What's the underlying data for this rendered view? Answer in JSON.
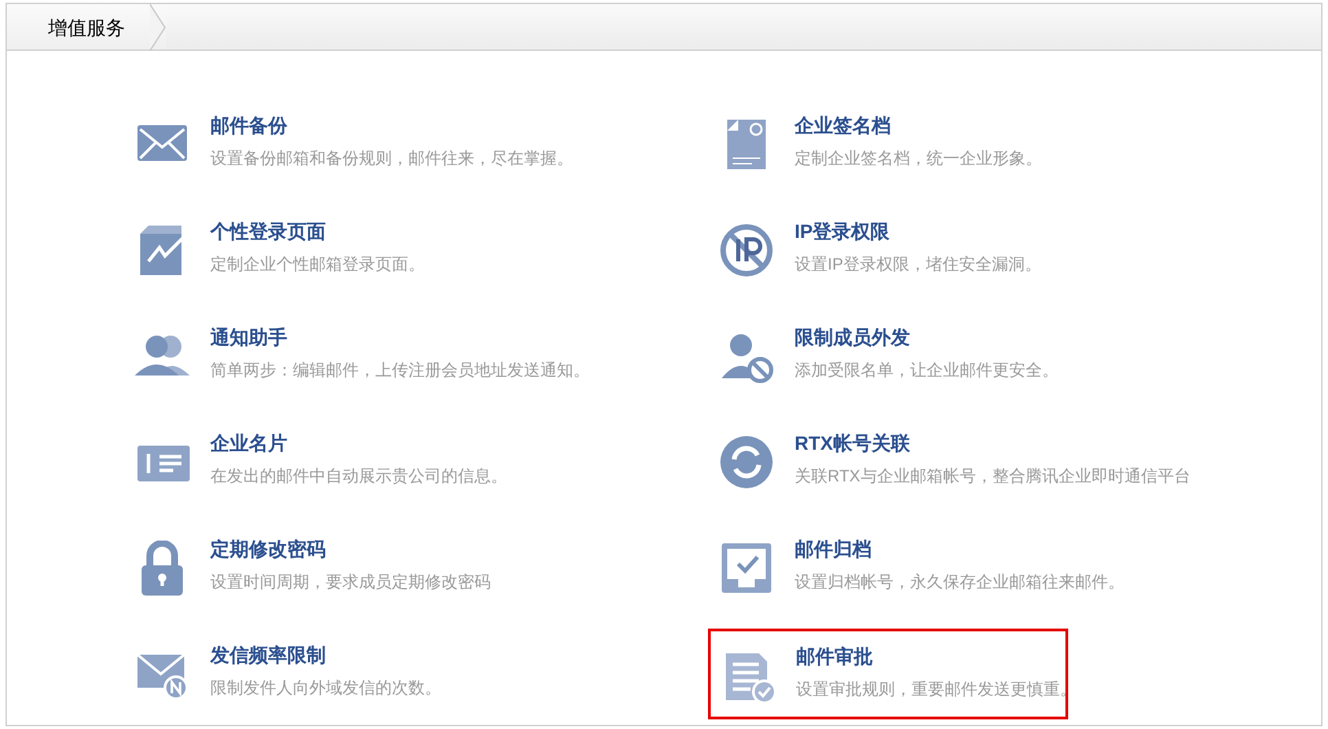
{
  "tab": {
    "label": "增值服务",
    "selected": true
  },
  "services": [
    {
      "title": "邮件备份",
      "description": "设置备份邮箱和备份规则，邮件往来，尽在掌握。",
      "highlighted": false
    },
    {
      "title": "企业签名档",
      "description": "定制企业签名档，统一企业形象。",
      "highlighted": false
    },
    {
      "title": "个性登录页面",
      "description": "定制企业个性邮箱登录页面。",
      "highlighted": false
    },
    {
      "title": "IP登录权限",
      "description": "设置IP登录权限，堵住安全漏洞。",
      "highlighted": false
    },
    {
      "title": "通知助手",
      "description": "简单两步：编辑邮件，上传注册会员地址发送通知。",
      "highlighted": false
    },
    {
      "title": "限制成员外发",
      "description": "添加受限名单，让企业邮件更安全。",
      "highlighted": false
    },
    {
      "title": "企业名片",
      "description": "在发出的邮件中自动展示贵公司的信息。",
      "highlighted": false
    },
    {
      "title": "RTX帐号关联",
      "description": "关联RTX与企业邮箱帐号，整合腾讯企业即时通信平台",
      "highlighted": false
    },
    {
      "title": "定期修改密码",
      "description": "设置时间周期，要求成员定期修改密码",
      "highlighted": false
    },
    {
      "title": "邮件归档",
      "description": "设置归档帐号，永久保存企业邮箱往来邮件。",
      "highlighted": false
    },
    {
      "title": "发信频率限制",
      "description": "限制发件人向外域发信的次数。",
      "highlighted": false
    },
    {
      "title": "邮件审批",
      "description": "设置审批规则，重要邮件发送更慎重。",
      "highlighted": true
    }
  ]
}
